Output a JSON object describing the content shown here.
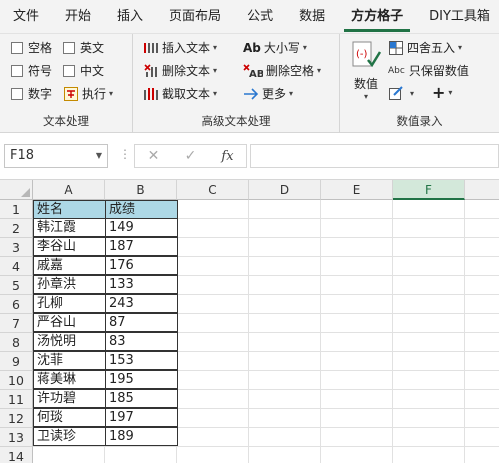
{
  "tabs": [
    "文件",
    "开始",
    "插入",
    "页面布局",
    "公式",
    "数据",
    "方方格子",
    "DIY工具箱"
  ],
  "active_tab": "方方格子",
  "groups": {
    "text_processing": {
      "title": "文本处理",
      "items": [
        "空格",
        "英文",
        "符号",
        "中文",
        "数字",
        "执行"
      ]
    },
    "advanced_text": {
      "title": "高级文本处理",
      "items": [
        "插入文本",
        "大小写",
        "删除文本",
        "删除空格",
        "截取文本",
        "更多"
      ]
    },
    "numeric_entry": {
      "title": "数值录入",
      "big_button": "数值",
      "items": [
        "四舍五入",
        "只保留数值",
        "+"
      ]
    }
  },
  "formula_bar": {
    "name_box": "F18",
    "fx": "fx",
    "formula": ""
  },
  "columns": [
    "A",
    "B",
    "C",
    "D",
    "E",
    "F"
  ],
  "selected_column": "F",
  "rows": [
    "1",
    "2",
    "3",
    "4",
    "5",
    "6",
    "7",
    "8",
    "9",
    "10",
    "11",
    "12",
    "13",
    "14"
  ],
  "table": {
    "headers": [
      "姓名",
      "成绩"
    ],
    "records": [
      [
        "韩江霞",
        "149"
      ],
      [
        "李谷山",
        "187"
      ],
      [
        "戚嘉",
        "176"
      ],
      [
        "孙章洪",
        "133"
      ],
      [
        "孔柳",
        "243"
      ],
      [
        "严谷山",
        "87"
      ],
      [
        "汤悦明",
        "83"
      ],
      [
        "沈菲",
        "153"
      ],
      [
        "蒋美琳",
        "195"
      ],
      [
        "许功碧",
        "185"
      ],
      [
        "何琰",
        "197"
      ],
      [
        "卫读珍",
        "189"
      ]
    ]
  },
  "colors": {
    "accent": "#217346",
    "header_fill": "#add8e6"
  }
}
